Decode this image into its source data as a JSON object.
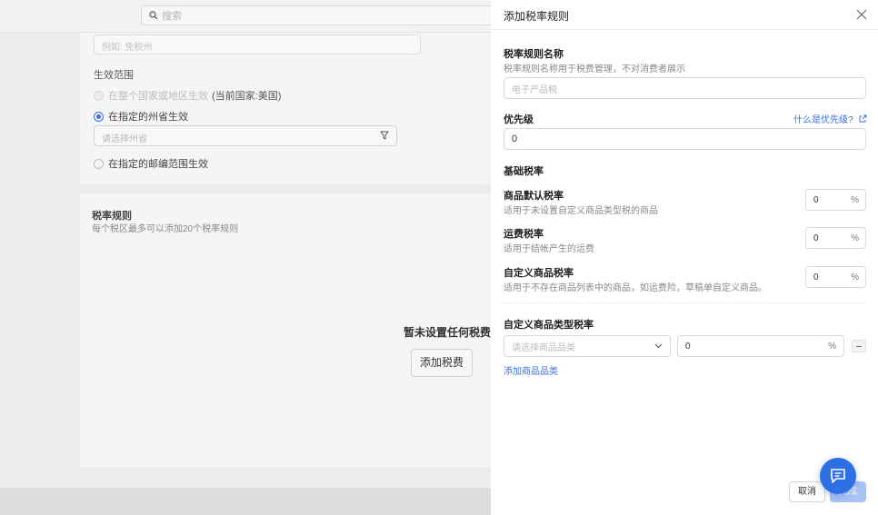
{
  "background": {
    "search": {
      "placeholder": "搜索"
    },
    "example_placeholder": "例如: 免税州",
    "scope": {
      "title": "生效范围",
      "opt_country": "在整个国家或地区生效",
      "current_country": "(当前国家:美国)",
      "opt_state": "在指定的州省生效",
      "state_placeholder": "请选择州省",
      "opt_zip": "在指定的邮编范围生效"
    },
    "rules": {
      "title": "税率规则",
      "subtitle": "每个税区最多可以添加20个税率规则",
      "empty_text": "暂未设置任何税费",
      "add_button": "添加税费"
    }
  },
  "drawer": {
    "title": "添加税率规则",
    "name": {
      "label": "税率规则名称",
      "help": "税率规则名称用于税费管理，不对消费者展示",
      "placeholder": "电子产品税"
    },
    "priority": {
      "label": "优先级",
      "link": "什么是优先级?",
      "value": "0"
    },
    "base_rate_title": "基础税率",
    "rates": [
      {
        "label": "商品默认税率",
        "help": "适用于未设置自定义商品类型税的商品",
        "value": "0",
        "unit": "%"
      },
      {
        "label": "运费税率",
        "help": "适用于结帐产生的运费",
        "value": "0",
        "unit": "%"
      },
      {
        "label": "自定义商品税率",
        "help": "适用于不存在商品列表中的商品，如运费险，草稿单自定义商品。",
        "value": "0",
        "unit": "%"
      }
    ],
    "category": {
      "title": "自定义商品类型税率",
      "select_placeholder": "请选择商品品类",
      "value": "0",
      "unit": "%",
      "add_link": "添加商品品类"
    },
    "cancel": "取消",
    "confirm": "完成"
  },
  "colors": {
    "accent": "#2f6fe4",
    "link": "#3a6fe0",
    "confirm_disabled": "#a9c3f3"
  }
}
